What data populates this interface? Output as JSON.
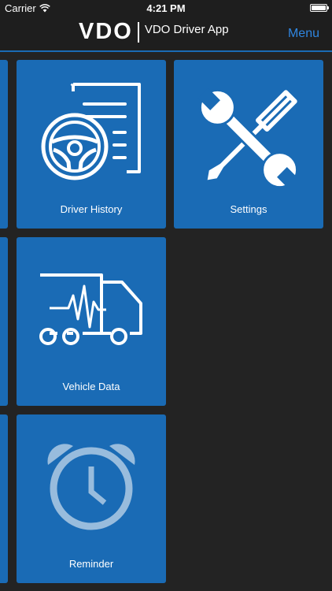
{
  "status_bar": {
    "carrier": "Carrier",
    "time": "4:21 PM",
    "wifi_icon": "wifi-icon",
    "battery_icon": "battery-icon"
  },
  "header": {
    "logo_mark": "VDO",
    "app_title": "VDO Driver App",
    "menu_label": "Menu"
  },
  "tiles": [
    {
      "label": "Driver History",
      "icon": "driver-history-icon"
    },
    {
      "label": "Settings",
      "icon": "tools-icon"
    },
    {
      "label": "Vehicle Data",
      "icon": "truck-diagnostics-icon"
    },
    {
      "label": "Reminder",
      "icon": "alarm-clock-icon"
    }
  ],
  "colors": {
    "background": "#232323",
    "tile": "#1a6bb5",
    "accent": "#2f86e0"
  }
}
